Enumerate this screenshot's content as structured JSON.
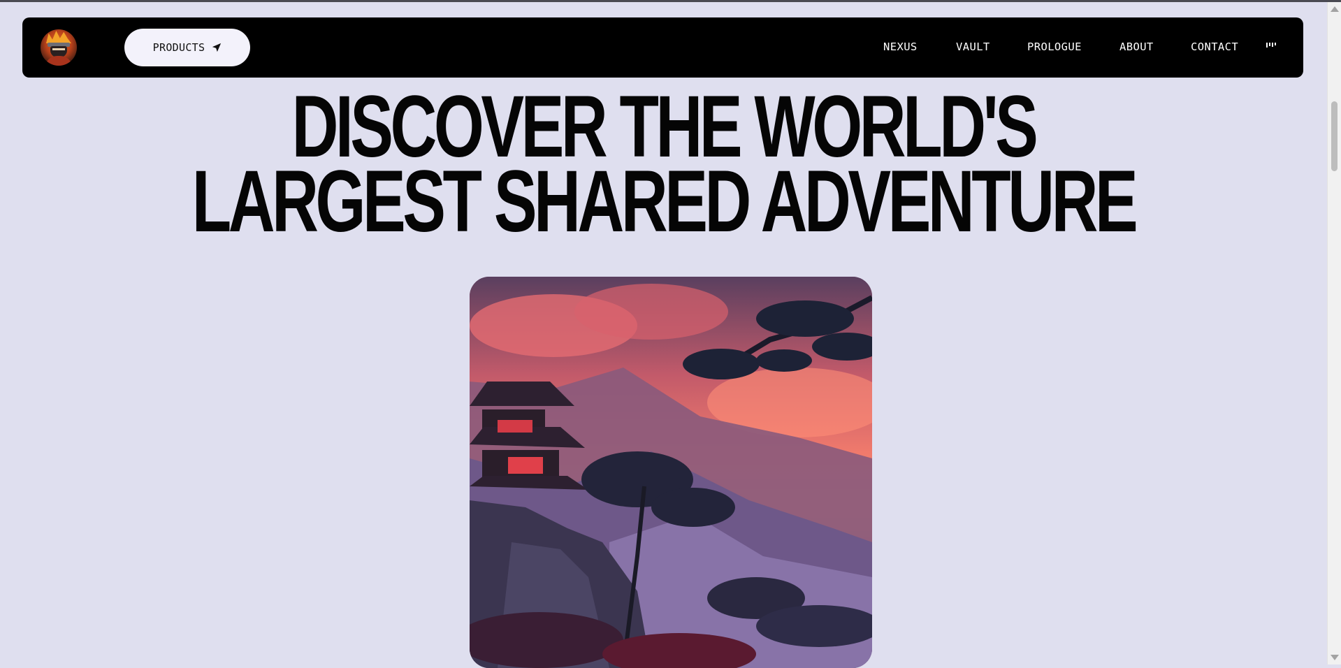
{
  "navbar": {
    "logo_icon": "ninja-avatar-logo",
    "products_label": "PRODUCTS",
    "products_icon": "send-arrow-icon",
    "links": [
      "NEXUS",
      "VAULT",
      "PROLOGUE",
      "ABOUT",
      "CONTACT"
    ],
    "menu_icon": "bars-icon"
  },
  "hero": {
    "title_line1": "DISCOVER THE WORLD'S",
    "title_line2": "LARGEST SHARED ADVENTURE",
    "image_alt": "pagoda-mountain-sunset-illustration"
  },
  "colors": {
    "background": "#dfdfef",
    "navbar": "#000000",
    "button": "#f3f2fb",
    "title": "#050505"
  }
}
